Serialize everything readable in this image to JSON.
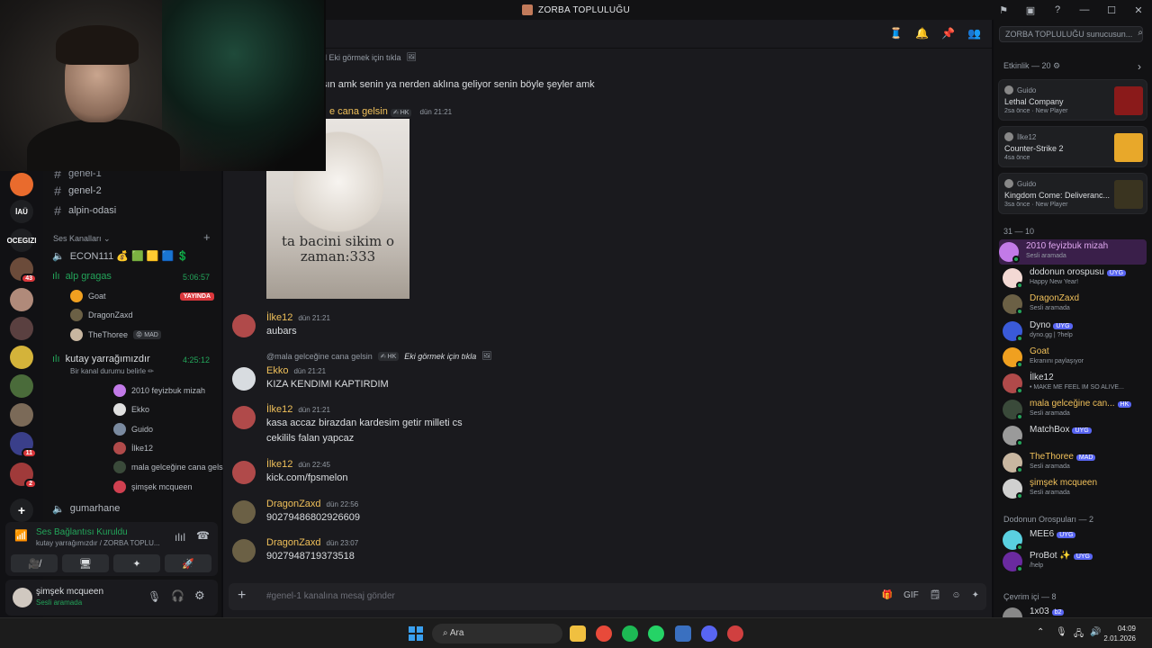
{
  "window": {
    "title": "ZORBA TOPLULUĞU",
    "controls": [
      "—",
      "☐",
      "✕"
    ]
  },
  "rail": {
    "servers": [
      {
        "label": "",
        "color": "#e96b2d"
      },
      {
        "label": "İAÜ",
        "color": "#1e1f22"
      },
      {
        "label": "OCEGIZI",
        "color": "#1e1f22"
      },
      {
        "label": "",
        "color": "#6b4b3a",
        "badge": "43"
      },
      {
        "label": "",
        "color": "#b08a7a"
      },
      {
        "label": "",
        "color": "#5a4040"
      },
      {
        "label": "",
        "color": "#d4b33a"
      },
      {
        "label": "",
        "color": "#4a6b3a"
      },
      {
        "label": "",
        "color": "#7b6a58"
      },
      {
        "label": "",
        "color": "#3a3f8a",
        "badge": "11"
      },
      {
        "label": "",
        "color": "#a03a3a",
        "badge": "2"
      }
    ],
    "add": "+"
  },
  "sidebar": {
    "text_channels": [
      "genel-1",
      "genel-2",
      "alpin-odasi"
    ],
    "voice_category": "Ses Kanalları",
    "voice_channels": [
      {
        "name": "ECON111 💰 🟩 🟨 🟦 💲",
        "users": []
      },
      {
        "name": "alp gragas",
        "time": "5:06:57",
        "users": [
          {
            "name": "Goat",
            "live": "YAYINDA"
          },
          {
            "name": "DragonZaxd"
          },
          {
            "name": "TheThoree",
            "tag": "😡 MAD"
          }
        ]
      },
      {
        "name": "kutay yarrağımızdır",
        "time": "4:25:12",
        "status": "Bir kanal durumu belirle ✏",
        "users": [
          {
            "name": "2010 feyizbuk mizah"
          },
          {
            "name": "Ekko"
          },
          {
            "name": "Guido"
          },
          {
            "name": "İlke12"
          },
          {
            "name": "mala gelceğine cana gelsin",
            "tag": "✍ HK"
          },
          {
            "name": "şimşek mcqueen"
          }
        ]
      },
      {
        "name": "gumarhane",
        "users": []
      }
    ],
    "voice_panel": {
      "title": "Ses Bağlantısı Kuruldu",
      "subtitle": "kutay yarrağımızdır / ZORBA TOPLU...",
      "buttons": [
        "🎥̸",
        "🖥",
        "✦",
        "🚀"
      ]
    },
    "user": {
      "name": "şimşek mcqueen",
      "status": "Sesli aramada"
    }
  },
  "main": {
    "header_icons": [
      "🧵",
      "🔔",
      "📌",
      "👥"
    ],
    "messages": [
      {
        "reply_tail": "d Eki görmek için tıkla",
        "line": "sın amk senin ya nerden aklına geliyor senin böyle şeyler amk"
      },
      {
        "name_tail": "e cana gelsin",
        "tag": "✍ HK",
        "time": "dün 21:21",
        "image_caption": "ta bacini sikim o zaman:333"
      },
      {
        "author": "İlke12",
        "time": "dün 21:21",
        "lines": [
          "aubars"
        ]
      },
      {
        "reply": "@mala gelceğine cana gelsin",
        "reply_tag": "✍ HK",
        "reply_extra": "Eki görmek için tıkla",
        "author": "Ekko",
        "time": "dün 21:21",
        "lines": [
          "KIZA KENDIMI KAPTIRDIM"
        ]
      },
      {
        "author": "İlke12",
        "time": "dün 21:21",
        "lines": [
          "kasa accaz birazdan kardesim getir milleti cs",
          "cekilils falan yapcaz"
        ]
      },
      {
        "author": "İlke12",
        "time": "dün 22:45",
        "lines": [
          "kick.com/fpsmelon"
        ]
      },
      {
        "author": "DragonZaxd",
        "time": "dün 22:56",
        "lines": [
          "90279486802926609"
        ]
      },
      {
        "author": "DragonZaxd",
        "time": "dün 23:07",
        "lines": [
          "9027948719373518"
        ]
      }
    ],
    "composer_placeholder": "#genel-1 kanalına mesaj gönder",
    "composer_icons": [
      "🎁",
      "GIF",
      "🗒",
      "☺",
      "✦"
    ]
  },
  "right": {
    "search_placeholder": "ZORBA TOPLULUĞU sunucusun...",
    "activity_header": "Etkinlik — 20",
    "activities": [
      {
        "who": "Guido",
        "game": "Lethal Company",
        "meta": "2sa önce · New Player",
        "color": "#8a1a1a"
      },
      {
        "who": "İlke12",
        "game": "Counter-Strike 2",
        "meta": "4sa önce",
        "color": "#e8a82a"
      },
      {
        "who": "Guido",
        "game": "Kingdom Come: Deliveranc...",
        "meta": "3sa önce · New Player",
        "color": "#3a3420"
      }
    ],
    "section_1": "31 — 10",
    "members_1": [
      {
        "name": "2010 feyizbuk mizah",
        "status": "Sesli aramada",
        "color": "#c27ae8",
        "highlight": true
      },
      {
        "name": "dodonun orospusu",
        "tag": "UYG",
        "status": "Happy New Year!",
        "color": "#f3d9d4"
      },
      {
        "name": "DragonZaxd",
        "status": "Sesli aramada",
        "color": "#6b6045"
      },
      {
        "name": "Dyno",
        "tag": "UYG",
        "status": "dyno.gg | ?help",
        "color": "#3a5ad8"
      },
      {
        "name": "Goat",
        "status": "Ekranını paylaşıyor",
        "color": "#f0a020"
      },
      {
        "name": "İlke12",
        "status": "• MAKE ME FEEL IM SO ALIVE...",
        "color": "#b04a4a"
      },
      {
        "name": "mala gelceğine can...",
        "tag": "HK",
        "status": "Sesli aramada",
        "color": "#3a4a3a"
      },
      {
        "name": "MatchBox",
        "tag": "UYG",
        "status": "",
        "color": "#9a9a9a"
      },
      {
        "name": "TheThoree",
        "tag": "MAD",
        "status": "Sesli aramada",
        "color": "#c8b6a0"
      },
      {
        "name": "şimşek mcqueen",
        "status": "Sesli aramada",
        "color": "#d0d0d0"
      }
    ],
    "section_2": "Dodonun Orospuları — 2",
    "members_2": [
      {
        "name": "MEE6",
        "tag": "UYG",
        "status": "",
        "color": "#5ad0e0"
      },
      {
        "name": "ProBot ✨",
        "tag": "UYG",
        "status": "/help",
        "color": "#6a2aa0"
      }
    ],
    "section_3": "Çevrim içi — 8",
    "members_3": [
      {
        "name": "1x03",
        "tag": "b2",
        "color": "#888"
      }
    ]
  },
  "taskbar": {
    "search": "Ara",
    "time": "04:09",
    "date": "2.01.2026"
  }
}
